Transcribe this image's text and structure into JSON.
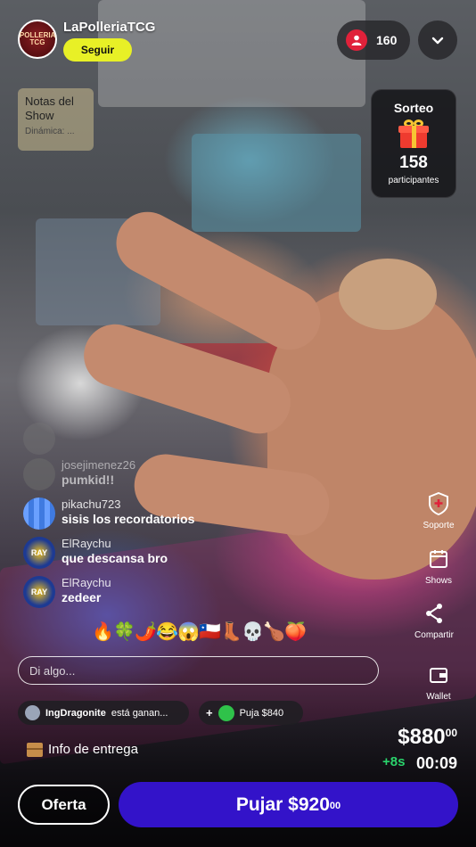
{
  "stream": {
    "channel_name": "LaPolleriaTCG",
    "avatar_text": "POLLERIA TCG",
    "follow_label": "Seguir",
    "viewer_count": "160"
  },
  "notes": {
    "title": "Notas del Show",
    "subtitle": "Dinámica: ..."
  },
  "giveaway": {
    "title": "Sorteo",
    "count": "158",
    "label": "participantes"
  },
  "chat": [
    {
      "user": "josejimenez26",
      "message": "pumkid!!"
    },
    {
      "user": "pikachu723",
      "message": "sisis los recordatorios"
    },
    {
      "user": "ElRaychu",
      "message": "que descansa bro",
      "avatar_text": "RAY"
    },
    {
      "user": "ElRaychu",
      "message": "zedeer",
      "avatar_text": "RAY"
    }
  ],
  "emojis": [
    "🔥",
    "🍀",
    "🌶️",
    "😂",
    "😱",
    "🇨🇱",
    "👢",
    "💀",
    "🍗",
    "🍑"
  ],
  "input": {
    "placeholder": "Di algo..."
  },
  "side_actions": {
    "support": "Soporte",
    "shows": "Shows",
    "share": "Compartir",
    "wallet": "Wallet"
  },
  "activity": {
    "winner_user": "IngDragonite",
    "winner_text": "está ganan...",
    "bid_label": "Puja $840"
  },
  "auction": {
    "delivery_label": "Info de entrega",
    "price": "$880",
    "price_cents": "00",
    "bonus": "+8s",
    "timer": "00:09"
  },
  "buttons": {
    "offer": "Oferta",
    "bid": "Pujar $920",
    "bid_cents": "00"
  },
  "colors": {
    "follow": "#e8f026",
    "bid_button": "#3313c9",
    "live_red": "#e0213a",
    "bonus_green": "#2ad46c"
  }
}
